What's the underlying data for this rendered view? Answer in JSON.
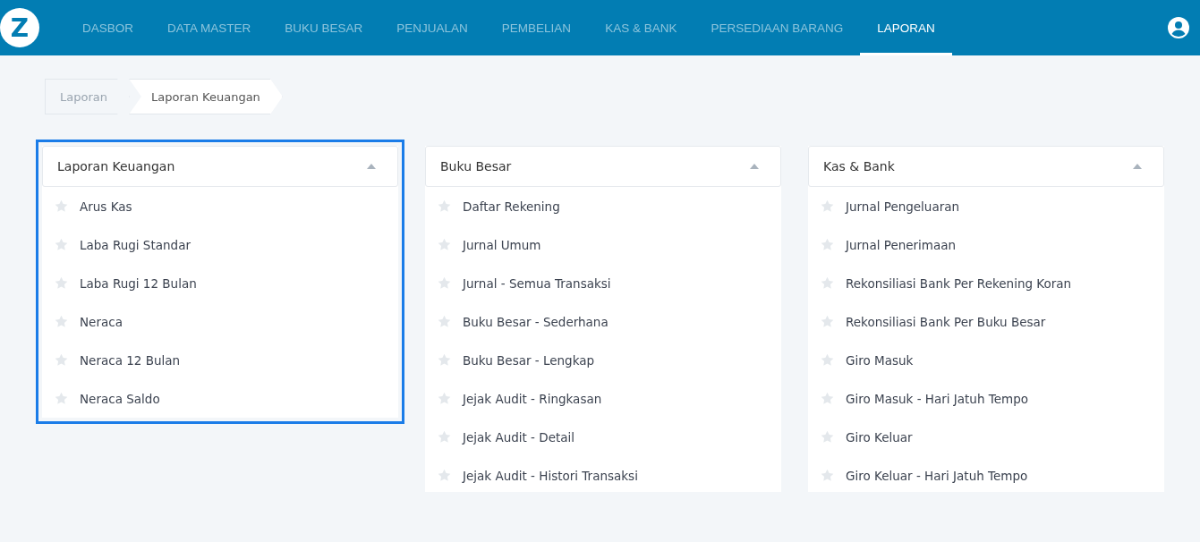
{
  "nav": {
    "items": [
      {
        "label": "DASBOR",
        "selected": false
      },
      {
        "label": "DATA MASTER",
        "selected": false
      },
      {
        "label": "BUKU BESAR",
        "selected": false
      },
      {
        "label": "PENJUALAN",
        "selected": false
      },
      {
        "label": "PEMBELIAN",
        "selected": false
      },
      {
        "label": "KAS & BANK",
        "selected": false
      },
      {
        "label": "PERSEDIAAN BARANG",
        "selected": false
      },
      {
        "label": "LAPORAN",
        "selected": true
      }
    ],
    "logo": "Z"
  },
  "breadcrumb": [
    {
      "label": "Laporan",
      "current": false
    },
    {
      "label": "Laporan Keuangan",
      "current": true
    }
  ],
  "panels": [
    {
      "title": "Laporan Keuangan",
      "focused": true,
      "expanded": true,
      "items": [
        {
          "label": "Arus Kas",
          "starred": false
        },
        {
          "label": "Laba Rugi Standar",
          "starred": false
        },
        {
          "label": "Laba Rugi 12 Bulan",
          "starred": false
        },
        {
          "label": "Neraca",
          "starred": false
        },
        {
          "label": "Neraca 12 Bulan",
          "starred": false
        },
        {
          "label": "Neraca Saldo",
          "starred": false
        }
      ]
    },
    {
      "title": "Buku Besar",
      "focused": false,
      "expanded": true,
      "items": [
        {
          "label": "Daftar Rekening",
          "starred": false
        },
        {
          "label": "Jurnal Umum",
          "starred": false
        },
        {
          "label": "Jurnal - Semua Transaksi",
          "starred": false
        },
        {
          "label": "Buku Besar - Sederhana",
          "starred": false
        },
        {
          "label": "Buku Besar - Lengkap",
          "starred": false
        },
        {
          "label": "Jejak Audit - Ringkasan",
          "starred": false
        },
        {
          "label": "Jejak Audit - Detail",
          "starred": false
        },
        {
          "label": "Jejak Audit - Histori Transaksi",
          "starred": false
        }
      ]
    },
    {
      "title": "Kas & Bank",
      "focused": false,
      "expanded": true,
      "items": [
        {
          "label": "Jurnal Pengeluaran",
          "starred": false
        },
        {
          "label": "Jurnal Penerimaan",
          "starred": false
        },
        {
          "label": "Rekonsiliasi Bank Per Rekening Koran",
          "starred": false
        },
        {
          "label": "Rekonsiliasi Bank Per Buku Besar",
          "starred": false
        },
        {
          "label": "Giro Masuk",
          "starred": false
        },
        {
          "label": "Giro Masuk - Hari Jatuh Tempo",
          "starred": false
        },
        {
          "label": "Giro Keluar",
          "starred": false
        },
        {
          "label": "Giro Keluar - Hari Jatuh Tempo",
          "starred": false
        }
      ]
    }
  ]
}
